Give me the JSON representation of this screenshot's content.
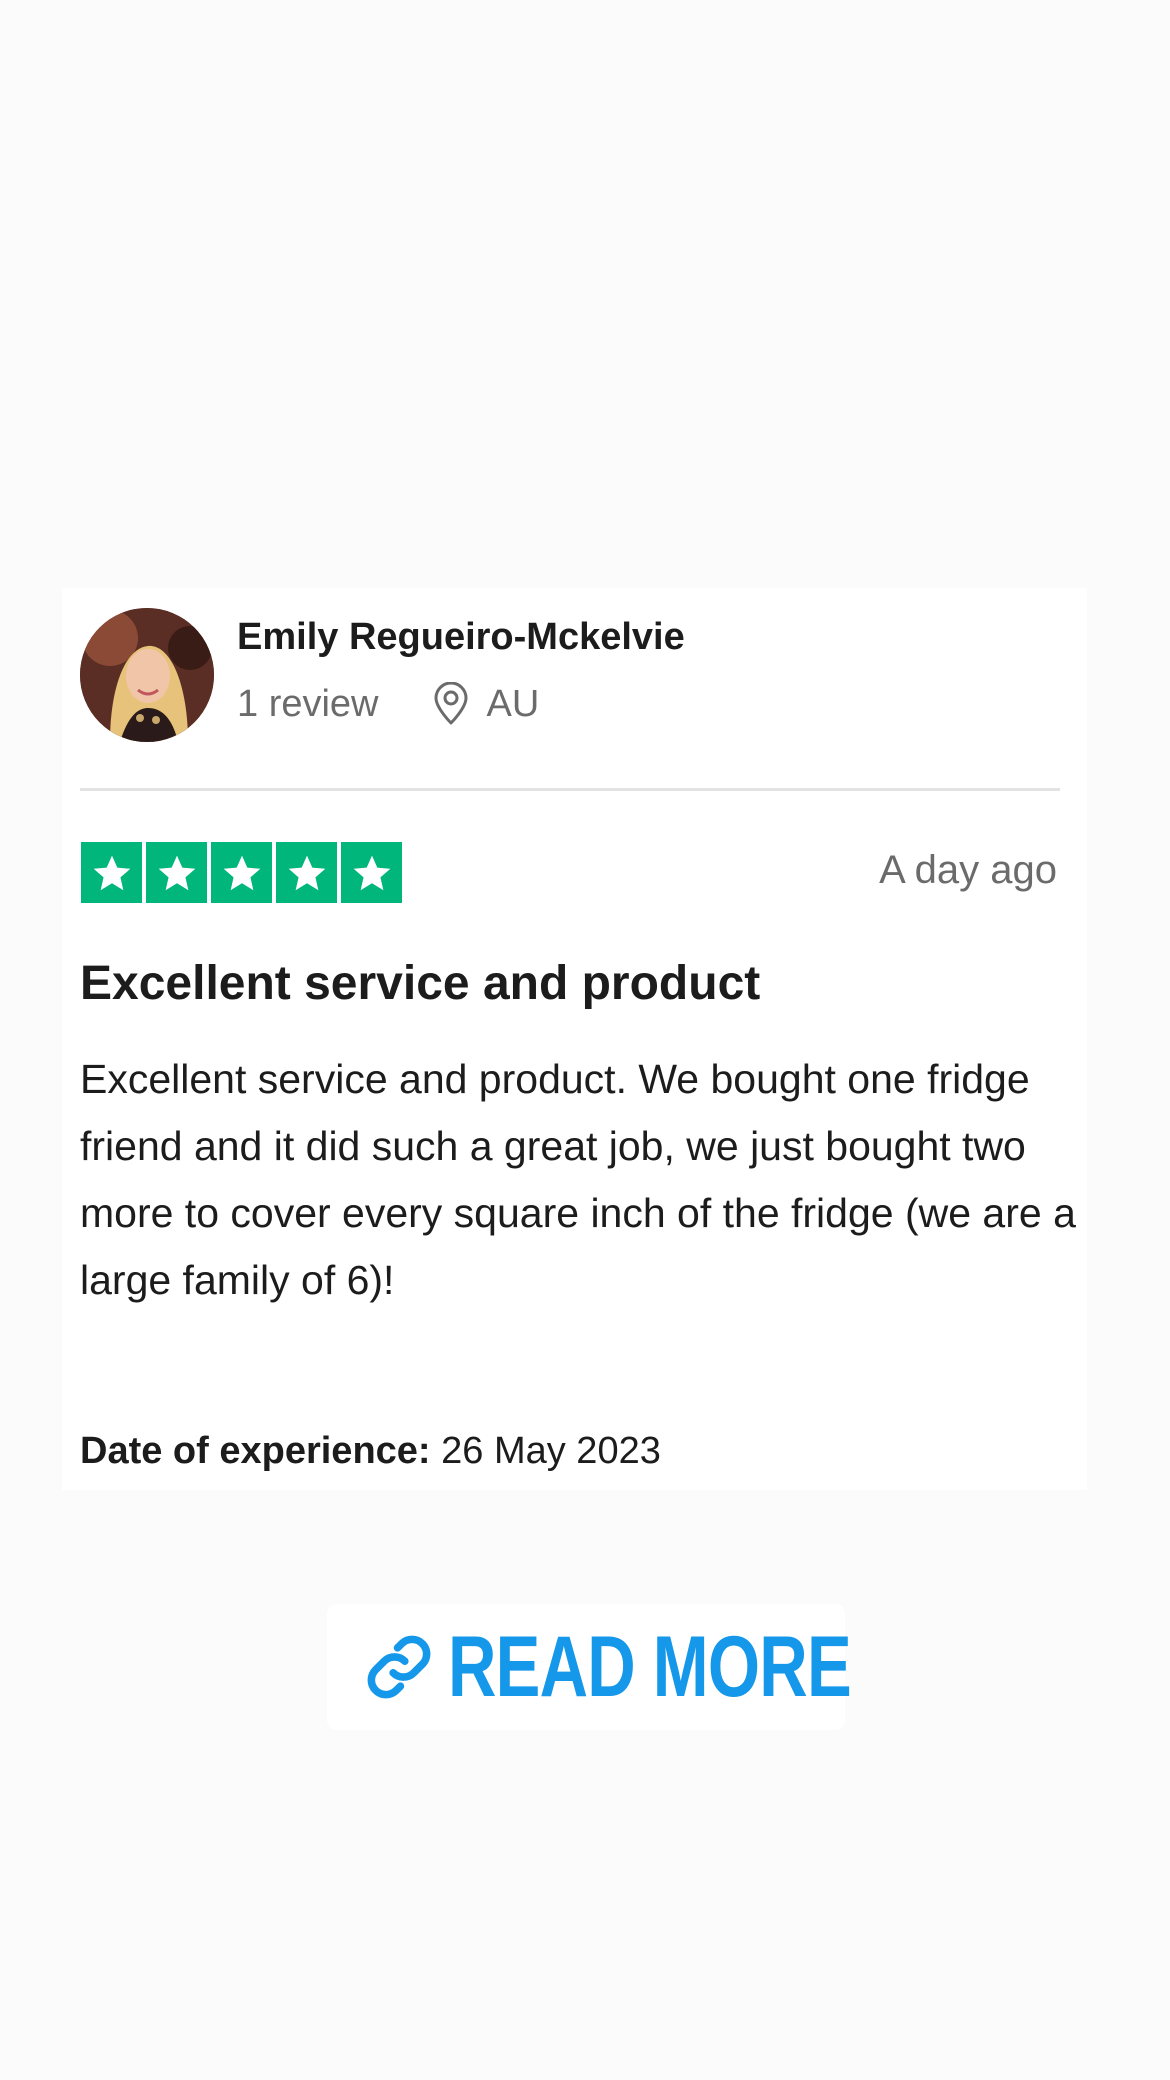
{
  "review": {
    "reviewer_name": "Emily Regueiro-Mckelvie",
    "review_count": "1 review",
    "location": "AU",
    "rating": 5,
    "rating_max": 5,
    "date_posted": "A day ago",
    "title": "Excellent service and product",
    "body": "Excellent service and product. We bought one fridge friend and it did such a great job, we just bought two more to cover every square inch of the fridge (we are a large family of 6)!",
    "experience_label": "Date of experience:",
    "experience_date": "26 May 2023"
  },
  "cta": {
    "label": "READ MORE",
    "icon": "link-icon"
  },
  "colors": {
    "star_green": "#00b67a",
    "link_blue": "#1597ea",
    "background": "#fbfbfb"
  }
}
